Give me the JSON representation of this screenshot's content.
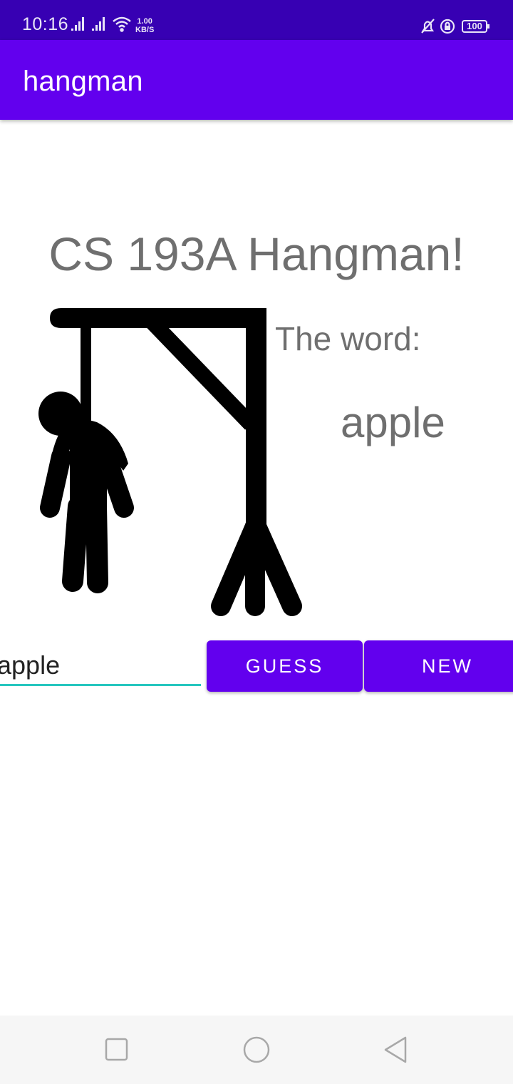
{
  "status_bar": {
    "time": "10:16",
    "net_speed_value": "1.00",
    "net_speed_unit": "KB/S",
    "battery": "100",
    "icons": [
      "signal-icon",
      "signal-icon",
      "wifi-icon",
      "bell-muted-icon",
      "lock-rotation-icon",
      "battery-icon"
    ]
  },
  "app_bar": {
    "title": "hangman",
    "color": "#6200ee"
  },
  "main": {
    "headline": "CS 193A Hangman!",
    "word_label": "The word:",
    "word_value": "apple",
    "hangman_image": "gallows-with-figure-icon"
  },
  "guess_row": {
    "input_value": "apple",
    "guess_button": "GUESS",
    "new_button": "NEW",
    "accent_color": "#26c6bf"
  },
  "nav_bar": {
    "icons": [
      "recents-icon",
      "home-icon",
      "back-icon"
    ]
  }
}
